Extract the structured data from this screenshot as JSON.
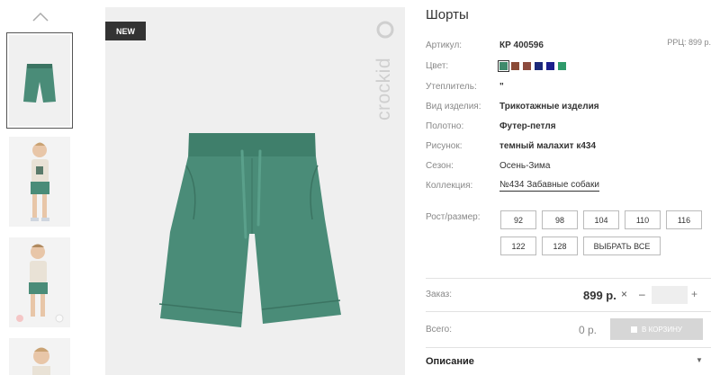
{
  "product": {
    "title": "Шорты",
    "rrp": "РРЦ: 899 р.",
    "badge": "NEW",
    "logo_text": "crockid",
    "article": {
      "label": "Артикул:",
      "value": "КР 400596"
    },
    "color": {
      "label": "Цвет:",
      "swatches": [
        "#3f8a6c",
        "#8a4a36",
        "#8c4b3e",
        "#1c2a7a",
        "#1c1f8c",
        "#2e9a6a"
      ]
    },
    "insulation": {
      "label": "Утеплитель:",
      "value": "\""
    },
    "kind": {
      "label": "Вид изделия:",
      "value": "Трикотажные изделия"
    },
    "fabric": {
      "label": "Полотно:",
      "value": "Футер-петля"
    },
    "pattern": {
      "label": "Рисунок:",
      "value": "темный малахит к434"
    },
    "season": {
      "label": "Сезон:",
      "value": "Осень-Зима"
    },
    "collection": {
      "label": "Коллекция:",
      "value": "№434 Забавные собаки"
    },
    "sizes": {
      "label": "Рост/размер:",
      "options": [
        "92",
        "98",
        "104",
        "110",
        "116",
        "122",
        "128"
      ],
      "select_all": "ВЫБРАТЬ ВСЕ"
    }
  },
  "order": {
    "label": "Заказ:",
    "price": "899 р.",
    "times": "×",
    "minus": "–",
    "plus": "+",
    "qty_value": ""
  },
  "total": {
    "label": "Всего:",
    "value": "0 р.",
    "cart_button": "В КОРЗИНУ"
  },
  "description": {
    "label": "Описание"
  },
  "colors": {
    "shorts": "#4a8c78",
    "shorts_dark": "#3b7462",
    "bg_image": "#efefef"
  }
}
